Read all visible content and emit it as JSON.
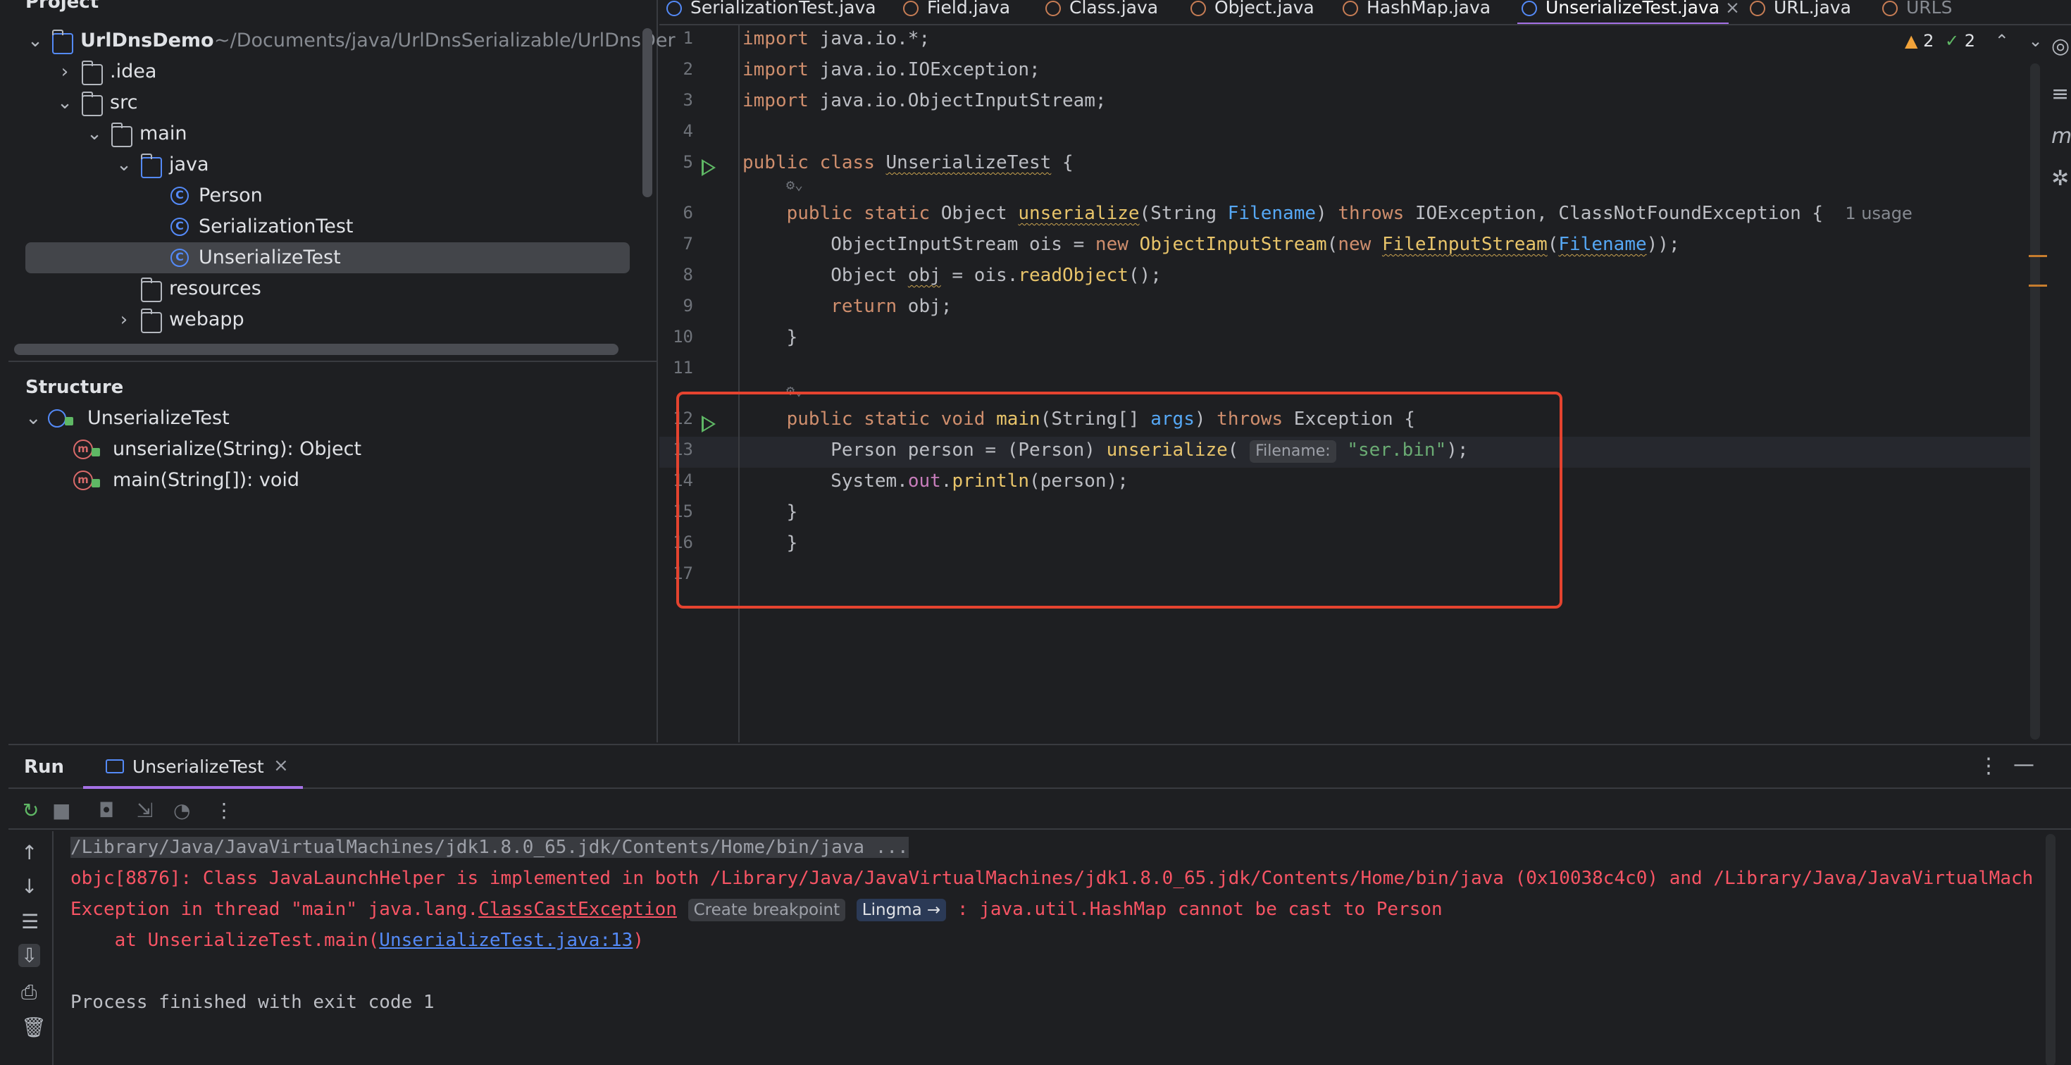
{
  "project": {
    "header": "Project",
    "tree": [
      {
        "label": "UrlDnsDemo",
        "hint": "~/Documents/java/UrlDnsSerializable/UrlDnsDer",
        "kind": "module",
        "depth": 0,
        "expanded": true
      },
      {
        "label": ".idea",
        "kind": "folder",
        "depth": 1,
        "expanded": false
      },
      {
        "label": "src",
        "kind": "folder",
        "depth": 1,
        "expanded": true
      },
      {
        "label": "main",
        "kind": "folder",
        "depth": 2,
        "expanded": true
      },
      {
        "label": "java",
        "kind": "source-folder",
        "depth": 3,
        "expanded": true
      },
      {
        "label": "Person",
        "kind": "class",
        "depth": 4
      },
      {
        "label": "SerializationTest",
        "kind": "class",
        "depth": 4
      },
      {
        "label": "UnserializeTest",
        "kind": "class",
        "depth": 4,
        "selected": true
      },
      {
        "label": "resources",
        "kind": "folder",
        "depth": 3
      },
      {
        "label": "webapp",
        "kind": "folder",
        "depth": 3,
        "expanded": false
      }
    ]
  },
  "structure": {
    "title": "Structure",
    "root": "UnserializeTest",
    "members": [
      "unserialize(String): Object",
      "main(String[]): void"
    ]
  },
  "tabs": [
    {
      "label": "SerializationTest.java",
      "icon": "class-icon"
    },
    {
      "label": "Field.java",
      "icon": "java-file-icon"
    },
    {
      "label": "Class.java",
      "icon": "java-file-icon"
    },
    {
      "label": "Object.java",
      "icon": "java-file-icon"
    },
    {
      "label": "HashMap.java",
      "icon": "java-file-icon"
    },
    {
      "label": "UnserializeTest.java",
      "icon": "class-icon",
      "active": true,
      "close": "×"
    },
    {
      "label": "URL.java",
      "icon": "java-file-icon"
    },
    {
      "label": "URLS",
      "icon": "java-file-icon"
    }
  ],
  "inspections": {
    "warnings": "2",
    "ok": "2"
  },
  "code": {
    "line_numbers": [
      "1",
      "2",
      "3",
      "4",
      "5",
      "6",
      "7",
      "8",
      "9",
      "10",
      "11",
      "12",
      "13",
      "14",
      "15",
      "16",
      "17"
    ],
    "usage_hint": "1 usage",
    "param_hint": "Filename:",
    "tokens": {
      "import": "import",
      "l1_pkg": " java.io.*;",
      "l2_pkg": " java.io.IOException;",
      "l3_pkg": " java.io.ObjectInputStream;",
      "public": "public",
      "class": "class",
      "static": "static",
      "void": "void",
      "throws": "throws",
      "new": "new",
      "return": "return",
      "class_name": "UnserializeTest",
      "brace_open": " {",
      "brace_close": "}",
      "object": "Object",
      "unserialize": "unserialize",
      "string": "String",
      "filename": "Filename",
      "l6_exceptions": " IOException, ClassNotFoundException {",
      "ois_decl": "ObjectInputStream ois = ",
      "ois_type": "ObjectInputStream",
      "fis_type": "FileInputStream",
      "l7_close": "));",
      "l8_a": "Object ",
      "obj": "obj",
      "l8_b": " = ois.",
      "readObject": "readObject",
      "l8_c": "();",
      "l9_obj": " obj;",
      "main": "main",
      "l12_sig": "(String[] ",
      "args": "args",
      "l12_exc": " Exception {",
      "l13_a": "Person person = (Person) ",
      "l13_str": "\"ser.bin\"",
      "l13_end": ");",
      "l14_a": "System.",
      "out": "out",
      "l14_b": ".",
      "println": "println",
      "l14_c": "(person);"
    }
  },
  "run": {
    "label": "Run",
    "tab": "UnserializeTest",
    "close": "×",
    "console": {
      "cmd": "/Library/Java/JavaVirtualMachines/jdk1.8.0_65.jdk/Contents/Home/bin/java ...",
      "objc": "objc[8876]: Class JavaLaunchHelper is implemented in both /Library/Java/JavaVirtualMachines/jdk1.8.0_65.jdk/Contents/Home/bin/java (0x10038c4c0) and /Library/Java/JavaVirtualMach",
      "exc_prefix": "Exception in thread \"main\" java.lang.",
      "exc_class": "ClassCastException",
      "create_breakpoint": "Create breakpoint",
      "lingma": "Lingma →",
      "exc_msg": ": java.util.HashMap cannot be cast to Person",
      "at_prefix": "    at UnserializeTest.main(",
      "at_link": "UnserializeTest.java:13",
      "at_suffix": ")",
      "exit": "Process finished with exit code 1"
    }
  },
  "colors": {
    "accent": "#a571e6",
    "error": "#f75464",
    "run_green": "#5fb865",
    "highlight_box": "#e5432f"
  }
}
